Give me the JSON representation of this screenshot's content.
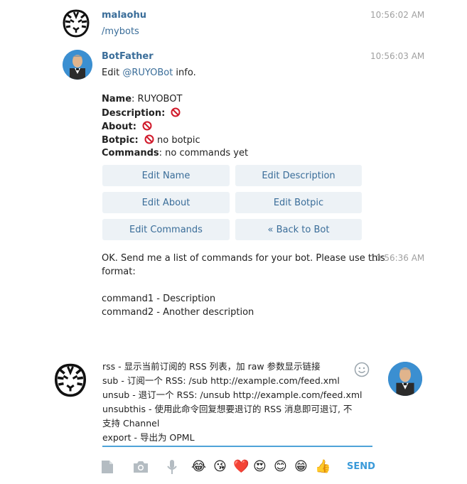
{
  "messages": {
    "m1": {
      "sender": "malaohu",
      "time": "10:56:02 AM",
      "text": "/mybots"
    },
    "m2": {
      "sender": "BotFather",
      "time": "10:56:03 AM",
      "edit_prefix": "Edit ",
      "edit_link": "@RUYOBot",
      "edit_suffix": " info.",
      "name_label": "Name",
      "name_value": "RUYOBOT",
      "description_label": "Description",
      "about_label": "About",
      "botpic_label": "Botpic",
      "botpic_value": "no botpic",
      "commands_label": "Commands",
      "commands_value": "no commands yet",
      "colon": ":"
    },
    "m3": {
      "time": "10:56:36 AM",
      "line1": "OK. Send me a list of commands for your bot. Please use this",
      "line2": "format:",
      "line3": "command1 - Description",
      "line4": "command2 - Another description"
    }
  },
  "keyboard": {
    "edit_name": "Edit Name",
    "edit_description": "Edit Description",
    "edit_about": "Edit About",
    "edit_botpic": "Edit Botpic",
    "edit_commands": "Edit Commands",
    "back_to_bot": "« Back to Bot"
  },
  "composer": {
    "lines": [
      "rss - 显示当前订阅的 RSS 列表，加 raw 参数显示链接",
      "sub - 订阅一个 RSS: /sub http://example.com/feed.xml",
      "unsub - 退订一个 RSS: /unsub http://example.com/feed.xml",
      "unsubthis - 使用此命令回复想要退订的 RSS 消息即可退订, 不",
      "支持 Channel",
      "export - 导出为 OPML"
    ],
    "send_label": "SEND"
  },
  "emojis": [
    "😂",
    "😘",
    "❤️",
    "😍",
    "😊",
    "😁",
    "👍"
  ],
  "colors": {
    "accent": "#3a6d99",
    "send": "#3a9ad9",
    "button_bg": "#edf2f6",
    "input_line": "#4fa3d8"
  }
}
